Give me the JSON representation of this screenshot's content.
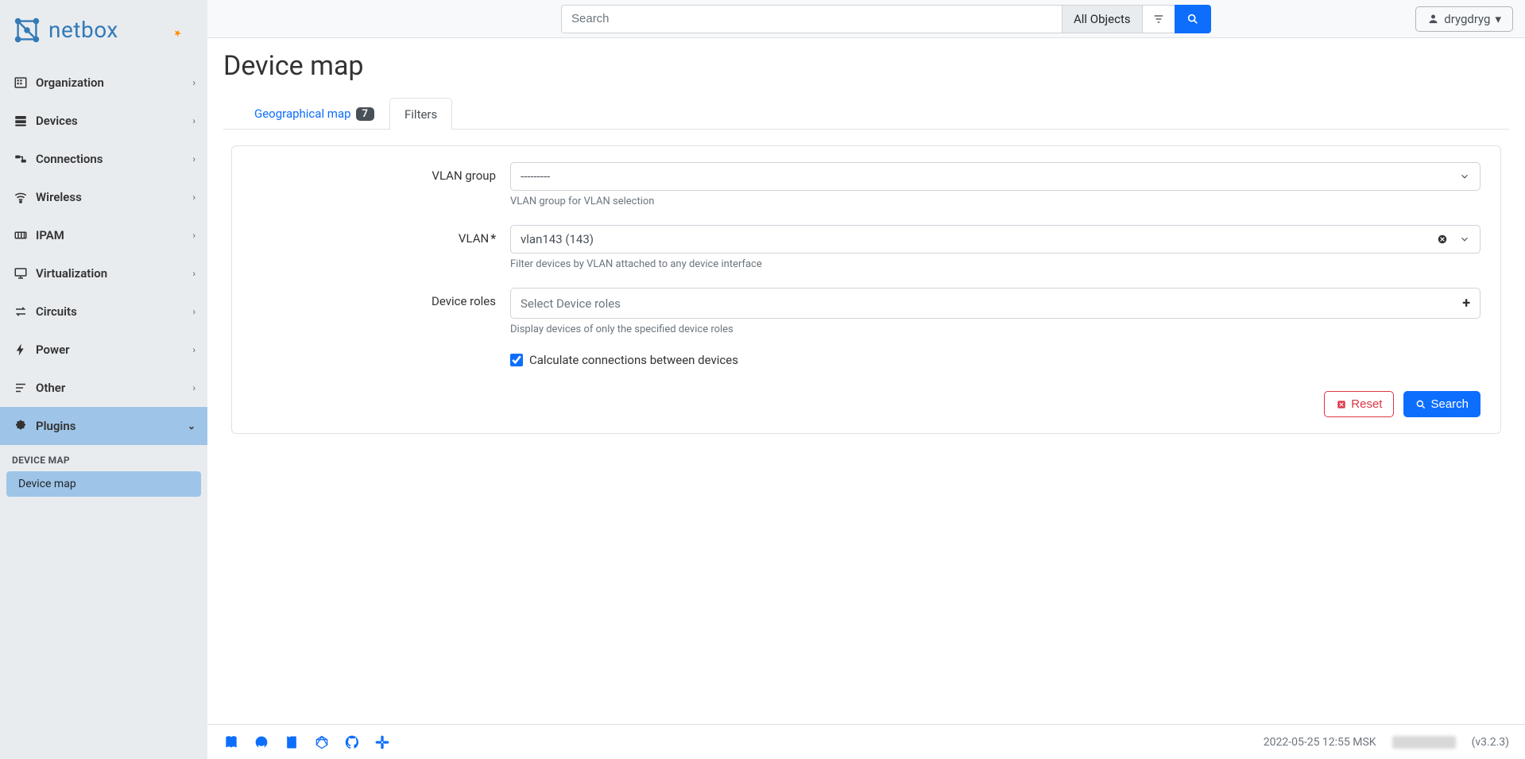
{
  "brand": "netbox",
  "topbar": {
    "search_placeholder": "Search",
    "search_type": "All Objects",
    "username": "drygdryg"
  },
  "sidebar": {
    "items": [
      {
        "label": "Organization"
      },
      {
        "label": "Devices"
      },
      {
        "label": "Connections"
      },
      {
        "label": "Wireless"
      },
      {
        "label": "IPAM"
      },
      {
        "label": "Virtualization"
      },
      {
        "label": "Circuits"
      },
      {
        "label": "Power"
      },
      {
        "label": "Other"
      },
      {
        "label": "Plugins"
      }
    ],
    "plugins_header": "DEVICE MAP",
    "plugins_item": "Device map"
  },
  "page": {
    "title": "Device map",
    "tabs": {
      "geo": "Geographical map",
      "geo_badge": "7",
      "filters": "Filters"
    }
  },
  "form": {
    "vlan_group": {
      "label": "VLAN group",
      "value": "---------",
      "help": "VLAN group for VLAN selection"
    },
    "vlan": {
      "label": "VLAN",
      "value": "vlan143 (143)",
      "help": "Filter devices by VLAN attached to any device interface"
    },
    "device_roles": {
      "label": "Device roles",
      "placeholder": "Select Device roles",
      "help": "Display devices of only the specified device roles"
    },
    "calc_conn": {
      "label": "Calculate connections between devices",
      "checked": true
    },
    "buttons": {
      "reset": "Reset",
      "search": "Search"
    }
  },
  "footer": {
    "timestamp": "2022-05-25 12:55 MSK",
    "version": "(v3.2.3)"
  }
}
